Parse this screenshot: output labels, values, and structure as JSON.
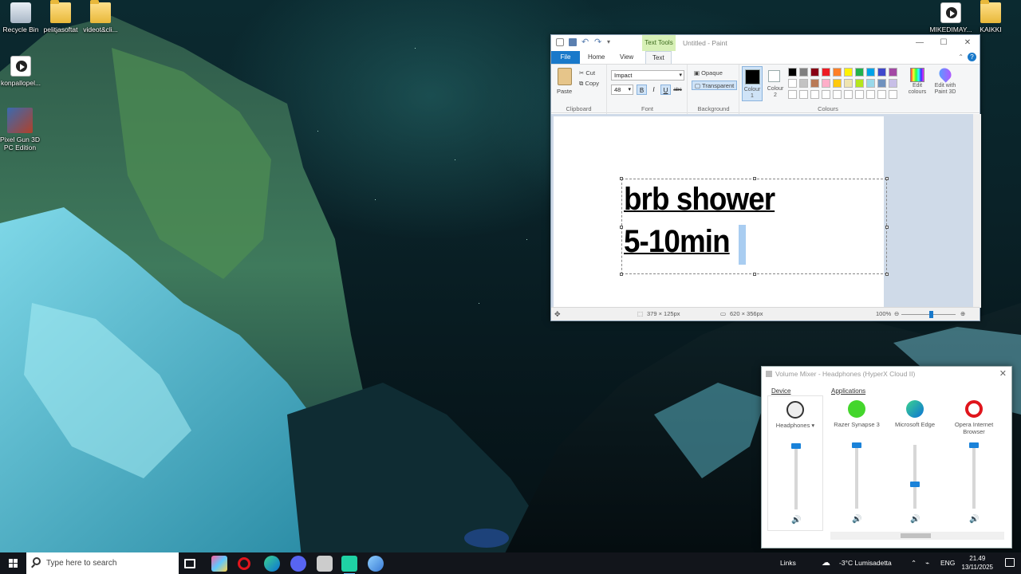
{
  "desktop": {
    "icons": [
      {
        "label": "Recycle Bin"
      },
      {
        "label": "pelitjasoftat"
      },
      {
        "label": "videot&cli..."
      },
      {
        "label": "konpallopel..."
      },
      {
        "label": "Pixel Gun 3D PC Edition"
      },
      {
        "label": "MIKEDIMAY..."
      },
      {
        "label": "KAIKKI"
      }
    ]
  },
  "paint": {
    "context_tab": "Text Tools",
    "title": "Untitled - Paint",
    "tabs": [
      "File",
      "Home",
      "View",
      "Text"
    ],
    "clipboard": {
      "paste": "Paste",
      "cut": "Cut",
      "copy": "Copy",
      "group": "Clipboard"
    },
    "font": {
      "family": "Impact",
      "size": "48",
      "bold": "B",
      "italic": "I",
      "underline": "U",
      "strike": "abc",
      "group": "Font"
    },
    "background": {
      "opaque": "Opaque",
      "transparent": "Transparent",
      "group": "Background"
    },
    "colours": {
      "colour1": "Colour 1",
      "colour2": "Colour 2",
      "edit": "Edit colours",
      "paint3d": "Edit with Paint 3D",
      "group": "Colours",
      "colour1_value": "#000000",
      "colour2_value": "#ffffff",
      "palette_row1": [
        "#000000",
        "#7f7f7f",
        "#880015",
        "#ed1c24",
        "#ff7f27",
        "#fff200",
        "#22b14c",
        "#00a2e8",
        "#3f48cc",
        "#a349a4"
      ],
      "palette_row2": [
        "#ffffff",
        "#c3c3c3",
        "#b97a57",
        "#ffaec9",
        "#ffc90e",
        "#efe4b0",
        "#b5e61d",
        "#99d9ea",
        "#7092be",
        "#c8bfe7"
      ]
    },
    "canvas_text": {
      "line1": "brb shower",
      "line2": "5-10min"
    },
    "status": {
      "selection": "379 × 125px",
      "canvas_size": "620 × 356px",
      "zoom": "100%"
    }
  },
  "mixer": {
    "title": "Volume Mixer - Headphones (HyperX Cloud II)",
    "device_label": "Device",
    "apps_label": "Applications",
    "channels": [
      {
        "name": "Headphones",
        "level": 1.0
      },
      {
        "name": "Razer Synapse 3",
        "level": 1.0
      },
      {
        "name": "Microsoft Edge",
        "level": 0.35
      },
      {
        "name": "Opera Internet Browser",
        "level": 1.0
      }
    ]
  },
  "taskbar": {
    "search_placeholder": "Type here to search",
    "links": "Links",
    "weather": "-3°C  Lumisadetta",
    "lang": "ENG",
    "time": "21.49",
    "date": "13/11/2025"
  }
}
